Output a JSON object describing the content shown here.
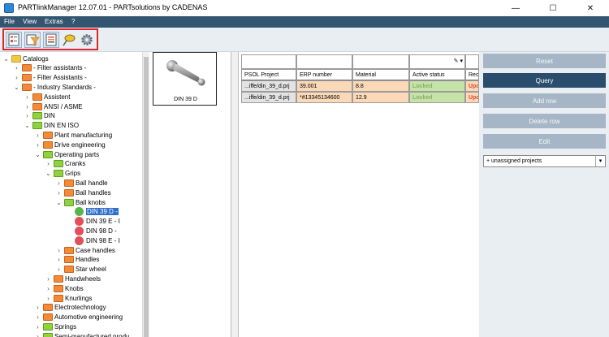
{
  "window": {
    "title": "PARTlinkManager 12.07.01 - PARTsolutions by CADENAS",
    "minimize_glyph": "—",
    "maximize_glyph": "☐",
    "close_glyph": "✕"
  },
  "menu": [
    "File",
    "View",
    "Extras",
    "?"
  ],
  "toolbar": {
    "highlight_color": "#e0242b",
    "buttons": [
      {
        "icon": "table-view-icon"
      },
      {
        "icon": "filter-icon"
      },
      {
        "icon": "document-list-icon"
      },
      {
        "icon": "lasso-select-icon"
      },
      {
        "icon": "gear-icon"
      }
    ]
  },
  "tree": {
    "nodes": [
      {
        "label": "Catalogs",
        "depth": 0,
        "expander": "minus",
        "folder": "yellow"
      },
      {
        "label": "- Filter assistants -",
        "depth": 1,
        "expander": "plus",
        "folder": "orange"
      },
      {
        "label": "- Filter Assistants -",
        "depth": 1,
        "expander": "plus",
        "folder": "orange"
      },
      {
        "label": "- Industry Standards -",
        "depth": 1,
        "expander": "minus",
        "folder": "orange"
      },
      {
        "label": "Assistent",
        "depth": 2,
        "expander": "plus",
        "folder": "orange"
      },
      {
        "label": "ANSI / ASME",
        "depth": 2,
        "expander": "plus",
        "folder": "orange"
      },
      {
        "label": "DIN",
        "depth": 2,
        "expander": "plus",
        "folder": "green"
      },
      {
        "label": "DIN EN ISO",
        "depth": 2,
        "expander": "minus",
        "folder": "green"
      },
      {
        "label": "Plant manufacturing",
        "depth": 3,
        "expander": "plus",
        "folder": "orange"
      },
      {
        "label": "Drive engineering",
        "depth": 3,
        "expander": "plus",
        "folder": "orange"
      },
      {
        "label": "Operating parts",
        "depth": 3,
        "expander": "minus",
        "folder": "green"
      },
      {
        "label": "Cranks",
        "depth": 4,
        "expander": "plus",
        "folder": "green"
      },
      {
        "label": "Grips",
        "depth": 4,
        "expander": "minus",
        "folder": "green"
      },
      {
        "label": "Ball handle",
        "depth": 5,
        "expander": "plus",
        "folder": "orange"
      },
      {
        "label": "Ball handles",
        "depth": 5,
        "expander": "plus",
        "folder": "orange"
      },
      {
        "label": "Ball knobs",
        "depth": 5,
        "expander": "minus",
        "folder": "green"
      },
      {
        "label": "DIN 39 D -",
        "depth": 6,
        "expander": "none",
        "folder": "part-green",
        "selected": true
      },
      {
        "label": "DIN 39 E - I",
        "depth": 6,
        "expander": "none",
        "folder": "part-red"
      },
      {
        "label": "DIN 98 D -",
        "depth": 6,
        "expander": "none",
        "folder": "part-red"
      },
      {
        "label": "DIN 98 E - I",
        "depth": 6,
        "expander": "none",
        "folder": "part-red"
      },
      {
        "label": "Case handles",
        "depth": 5,
        "expander": "plus",
        "folder": "orange"
      },
      {
        "label": "Handles",
        "depth": 5,
        "expander": "plus",
        "folder": "orange"
      },
      {
        "label": "Star wheel",
        "depth": 5,
        "expander": "plus",
        "folder": "orange"
      },
      {
        "label": "Handwheels",
        "depth": 4,
        "expander": "plus",
        "folder": "orange"
      },
      {
        "label": "Knobs",
        "depth": 4,
        "expander": "plus",
        "folder": "orange"
      },
      {
        "label": "Knurlings",
        "depth": 4,
        "expander": "plus",
        "folder": "orange"
      },
      {
        "label": "Electrotechnology",
        "depth": 3,
        "expander": "plus",
        "folder": "orange"
      },
      {
        "label": "Automotive engineering",
        "depth": 3,
        "expander": "plus",
        "folder": "orange"
      },
      {
        "label": "Springs",
        "depth": 3,
        "expander": "plus",
        "folder": "green"
      },
      {
        "label": "Semi-manufactured produ",
        "depth": 3,
        "expander": "plus",
        "folder": "green"
      }
    ]
  },
  "preview": {
    "caption": "DIN 39 D",
    "icon": "ball-knob-part-icon"
  },
  "grid": {
    "columns": [
      "PSOL Project",
      "ERP number",
      "Material",
      "Active status",
      "Rec"
    ],
    "filter_icons": [
      "",
      "",
      "",
      "pencil-icon",
      ""
    ],
    "rows": [
      [
        "...iffe/din_39_d.prj",
        "39.001",
        "8.8",
        "Locked",
        "Upd"
      ],
      [
        "...iffe/din_39_d.prj",
        "*#13345134600",
        "12.9",
        "Locked",
        "Upd"
      ]
    ]
  },
  "actions": {
    "buttons": [
      {
        "label": "Reset",
        "active": false
      },
      {
        "label": "Query",
        "active": true
      },
      {
        "label": "Add row",
        "active": false
      },
      {
        "label": "Delete row",
        "active": false
      },
      {
        "label": "Edit",
        "active": false
      }
    ],
    "project_select": "+ unassigned projects"
  }
}
